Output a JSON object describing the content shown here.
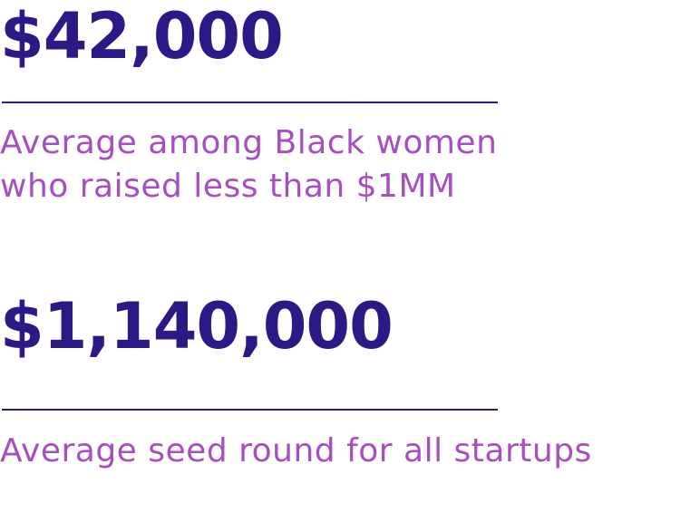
{
  "stats": [
    {
      "figure": "$42,000",
      "caption_lines": [
        "Average among Black women",
        "who raised less than $1MM"
      ]
    },
    {
      "figure": "$1,140,000",
      "caption_lines": [
        "Average seed round for all startups"
      ]
    }
  ],
  "colors": {
    "figure": "#2b1a85",
    "rule": "#2b1a85",
    "caption": "#a64fc2",
    "background": "#ffffff"
  }
}
